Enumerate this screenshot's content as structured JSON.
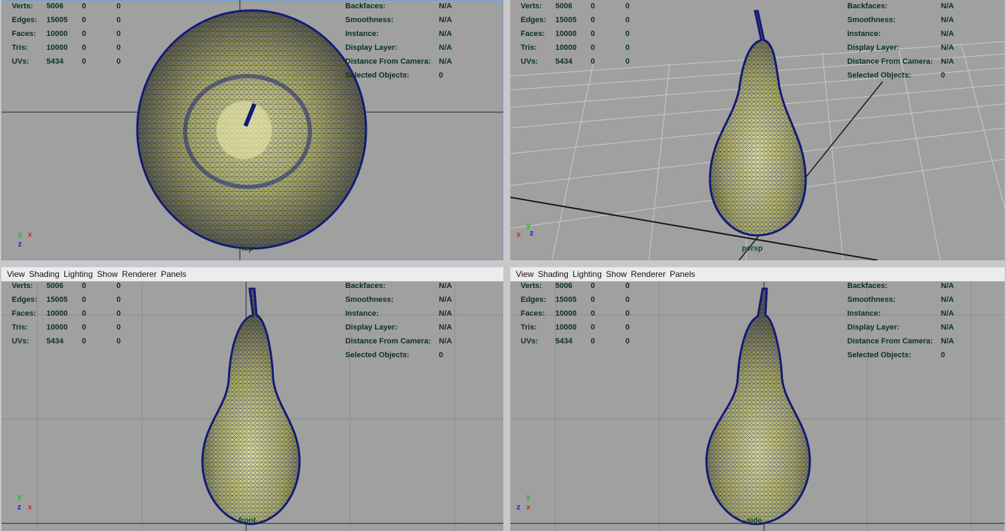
{
  "menu": [
    "View",
    "Shading",
    "Lighting",
    "Show",
    "Renderer",
    "Panels"
  ],
  "stats": {
    "labels": [
      "Verts:",
      "Edges:",
      "Faces:",
      "Tris:",
      "UVs:"
    ],
    "values": [
      [
        "5006",
        "0",
        "0"
      ],
      [
        "15005",
        "0",
        "0"
      ],
      [
        "10000",
        "0",
        "0"
      ],
      [
        "10000",
        "0",
        "0"
      ],
      [
        "5434",
        "0",
        "0"
      ]
    ]
  },
  "display": {
    "labels": [
      "Backfaces:",
      "Smoothness:",
      "Instance:",
      "Display Layer:",
      "Distance From Camera:",
      "Selected Objects:"
    ],
    "values": [
      "N/A",
      "N/A",
      "N/A",
      "N/A",
      "N/A",
      "0"
    ]
  },
  "cameras": {
    "top": "top",
    "persp": "persp",
    "front": "front",
    "side": "side"
  },
  "axes": {
    "x": "x",
    "y": "y",
    "z": "z"
  },
  "colors": {
    "viewport_bg": "#a0a0a0",
    "wire": "#101a78",
    "hud_text": "#08331a",
    "fruit": "#c8c878"
  }
}
